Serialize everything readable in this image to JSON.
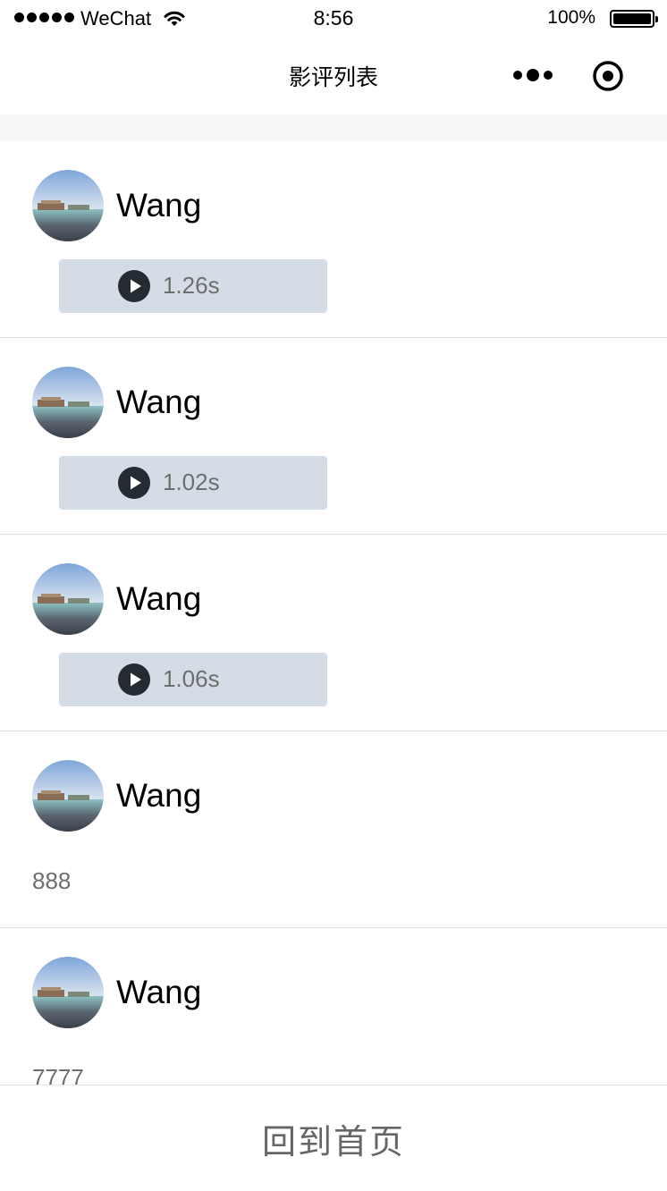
{
  "status_bar": {
    "carrier": "WeChat",
    "time": "8:56",
    "battery": "100%"
  },
  "nav": {
    "title": "影评列表"
  },
  "reviews": [
    {
      "user_name": "Wang",
      "type": "voice",
      "duration": "1.26s"
    },
    {
      "user_name": "Wang",
      "type": "voice",
      "duration": "1.02s"
    },
    {
      "user_name": "Wang",
      "type": "voice",
      "duration": "1.06s"
    },
    {
      "user_name": "Wang",
      "type": "text",
      "content": "888"
    },
    {
      "user_name": "Wang",
      "type": "text",
      "content": "7777"
    }
  ],
  "footer": {
    "home_label": "回到首页"
  },
  "colors": {
    "voice_bubble": "#d4dde5",
    "play_icon": "#232b33",
    "secondary_text": "#6e6e6e"
  },
  "icons": {
    "avatar": "avatar-photo",
    "voice": "play-icon",
    "more": "more-icon",
    "close": "close-target-icon"
  }
}
